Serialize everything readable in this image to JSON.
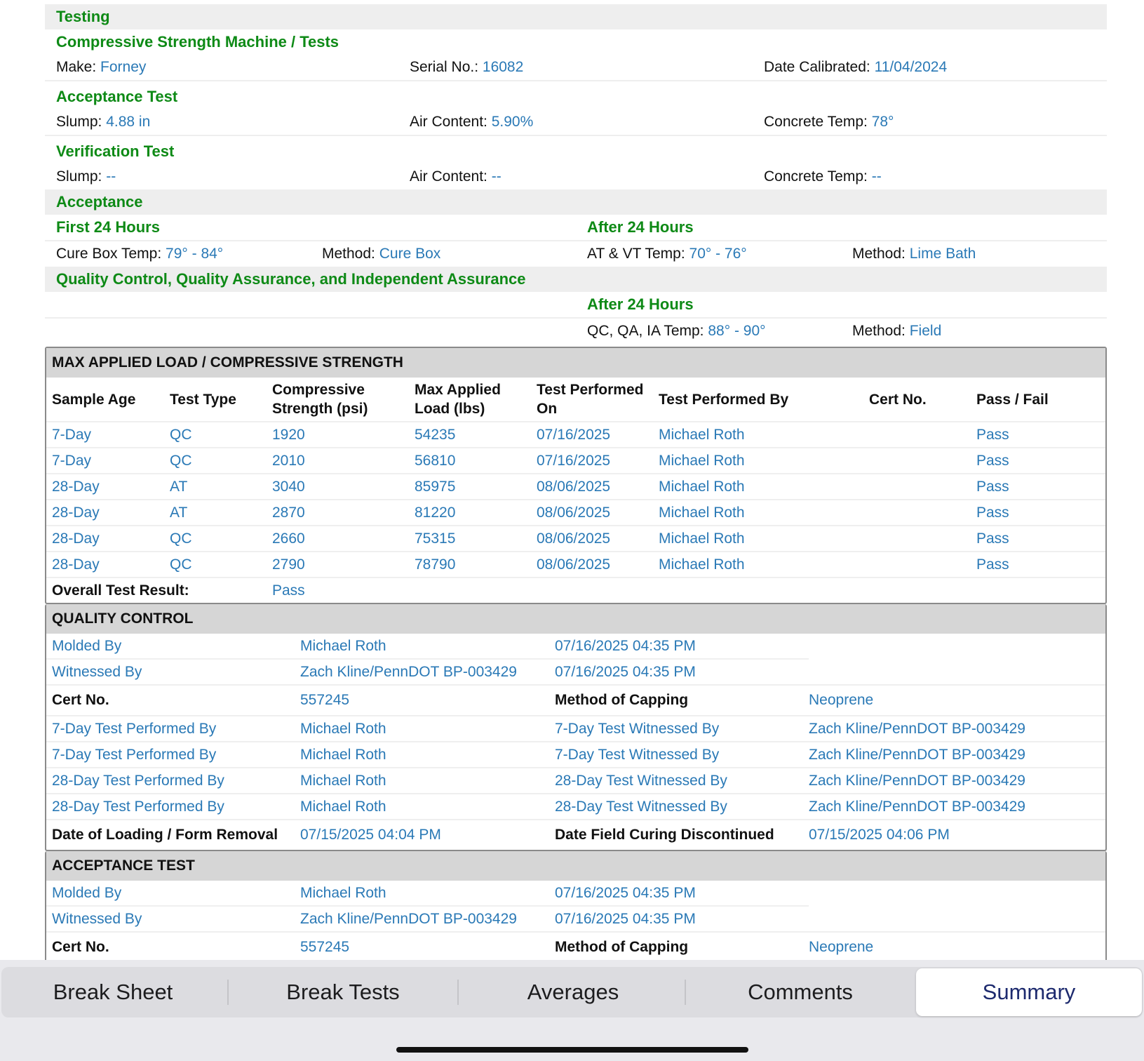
{
  "testing": {
    "title": "Testing",
    "machine_title": "Compressive Strength Machine / Tests",
    "make_label": "Make:",
    "make": "Forney",
    "serial_label": "Serial No.:",
    "serial": "16082",
    "calibrated_label": "Date Calibrated:",
    "calibrated": "11/04/2024"
  },
  "acceptance_test": {
    "title": "Acceptance Test",
    "slump_label": "Slump:",
    "slump": "4.88 in",
    "air_label": "Air Content:",
    "air": "5.90%",
    "temp_label": "Concrete Temp:",
    "temp": "78°"
  },
  "verification_test": {
    "title": "Verification Test",
    "slump_label": "Slump:",
    "slump": "--",
    "air_label": "Air Content:",
    "air": "--",
    "temp_label": "Concrete Temp:",
    "temp": "--"
  },
  "acceptance": {
    "title": "Acceptance",
    "first24": "First 24 Hours",
    "after24": "After 24 Hours",
    "curebox_label": "Cure Box Temp:",
    "curebox": "79° - 84°",
    "method1_label": "Method:",
    "method1": "Cure Box",
    "atvt_label": "AT & VT Temp:",
    "atvt": "70° - 76°",
    "method2_label": "Method:",
    "method2": "Lime Bath"
  },
  "qc_qa_ia": {
    "title": "Quality Control, Quality Assurance, and Independent Assurance",
    "after24": "After 24 Hours",
    "temp_label": "QC, QA, IA Temp:",
    "temp": "88° - 90°",
    "method_label": "Method:",
    "method": "Field"
  },
  "max_load": {
    "title": "MAX APPLIED LOAD / COMPRESSIVE STRENGTH",
    "headers": [
      "Sample Age",
      "Test Type",
      "Compressive Strength (psi)",
      "Max Applied Load (lbs)",
      "Test Performed On",
      "Test Performed By",
      "Cert No.",
      "Pass / Fail"
    ],
    "rows": [
      [
        "7-Day",
        "QC",
        "1920",
        "54235",
        "07/16/2025",
        "Michael Roth",
        "",
        "Pass"
      ],
      [
        "7-Day",
        "QC",
        "2010",
        "56810",
        "07/16/2025",
        "Michael Roth",
        "",
        "Pass"
      ],
      [
        "28-Day",
        "AT",
        "3040",
        "85975",
        "08/06/2025",
        "Michael Roth",
        "",
        "Pass"
      ],
      [
        "28-Day",
        "AT",
        "2870",
        "81220",
        "08/06/2025",
        "Michael Roth",
        "",
        "Pass"
      ],
      [
        "28-Day",
        "QC",
        "2660",
        "75315",
        "08/06/2025",
        "Michael Roth",
        "",
        "Pass"
      ],
      [
        "28-Day",
        "QC",
        "2790",
        "78790",
        "08/06/2025",
        "Michael Roth",
        "",
        "Pass"
      ]
    ],
    "overall_label": "Overall Test Result:",
    "overall": "Pass"
  },
  "quality_control": {
    "title": "QUALITY CONTROL",
    "molded_label": "Molded By",
    "molded_by": "Michael Roth",
    "molded_date": "07/16/2025 04:35 PM",
    "witnessed_label": "Witnessed By",
    "witnessed_by": "Zach Kline/PennDOT BP-003429",
    "witnessed_date": "07/16/2025 04:35 PM",
    "cert_label": "Cert No.",
    "cert": "557245",
    "capping_label": "Method of Capping",
    "capping": "Neoprene",
    "performed": [
      [
        "7-Day Test Performed By",
        "Michael Roth",
        "7-Day Test Witnessed By",
        "Zach Kline/PennDOT BP-003429"
      ],
      [
        "7-Day Test Performed By",
        "Michael Roth",
        "7-Day Test Witnessed By",
        "Zach Kline/PennDOT BP-003429"
      ],
      [
        "28-Day Test Performed By",
        "Michael Roth",
        "28-Day Test Witnessed By",
        "Zach Kline/PennDOT BP-003429"
      ],
      [
        "28-Day Test Performed By",
        "Michael Roth",
        "28-Day Test Witnessed By",
        "Zach Kline/PennDOT BP-003429"
      ]
    ],
    "loading_label": "Date of Loading / Form Removal",
    "loading": "07/15/2025 04:04 PM",
    "curing_label": "Date Field Curing Discontinued",
    "curing": "07/15/2025 04:06 PM"
  },
  "acceptance_box": {
    "title": "ACCEPTANCE TEST",
    "molded_label": "Molded By",
    "molded_by": "Michael Roth",
    "molded_date": "07/16/2025 04:35 PM",
    "witnessed_label": "Witnessed By",
    "witnessed_by": "Zach Kline/PennDOT BP-003429",
    "witnessed_date": "07/16/2025 04:35 PM",
    "cert_label": "Cert No.",
    "cert": "557245",
    "capping_label": "Method of Capping",
    "capping": "Neoprene"
  },
  "tabs": [
    "Break Sheet",
    "Break Tests",
    "Averages",
    "Comments",
    "Summary"
  ],
  "selected_tab": "Summary"
}
